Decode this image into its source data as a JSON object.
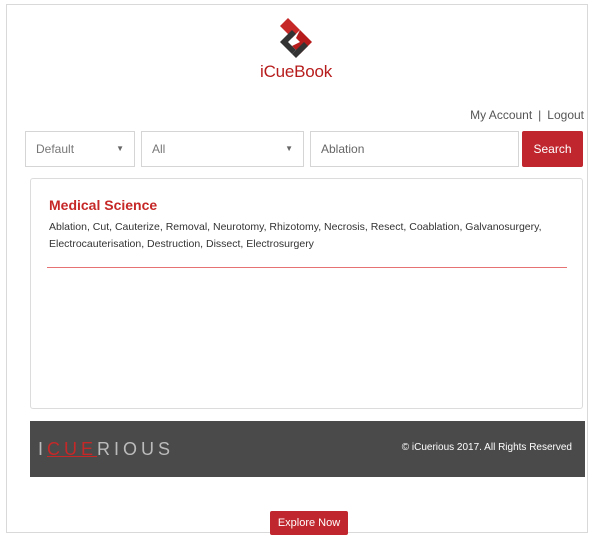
{
  "header": {
    "brand": "iCueBook",
    "logo_icon": "diamond-logo-icon"
  },
  "account": {
    "my_account": "My Account",
    "separator": "|",
    "logout": "Logout"
  },
  "search": {
    "select1": "Default",
    "select2": "All",
    "query_value": "Ablation",
    "button": "Search",
    "caret_icon": "chevron-down-icon"
  },
  "result": {
    "category": "Medical Science",
    "terms": "Ablation, Cut, Cauterize, Removal, Neurotomy, Rhizotomy, Necrosis, Resect, Coablation, Galvanosurgery, Electrocauterisation, Destruction, Dissect, Electrosurgery"
  },
  "footer": {
    "wordmark_prefix": "I",
    "wordmark_highlight": "CUE",
    "wordmark_suffix": "RIOUS",
    "copyright": "© iCuerious 2017. All Rights Reserved"
  },
  "cta": {
    "explore": "Explore Now"
  },
  "colors": {
    "accent": "#c0262d",
    "footer_bg": "#4a4a4a",
    "rule": "#e57373"
  }
}
